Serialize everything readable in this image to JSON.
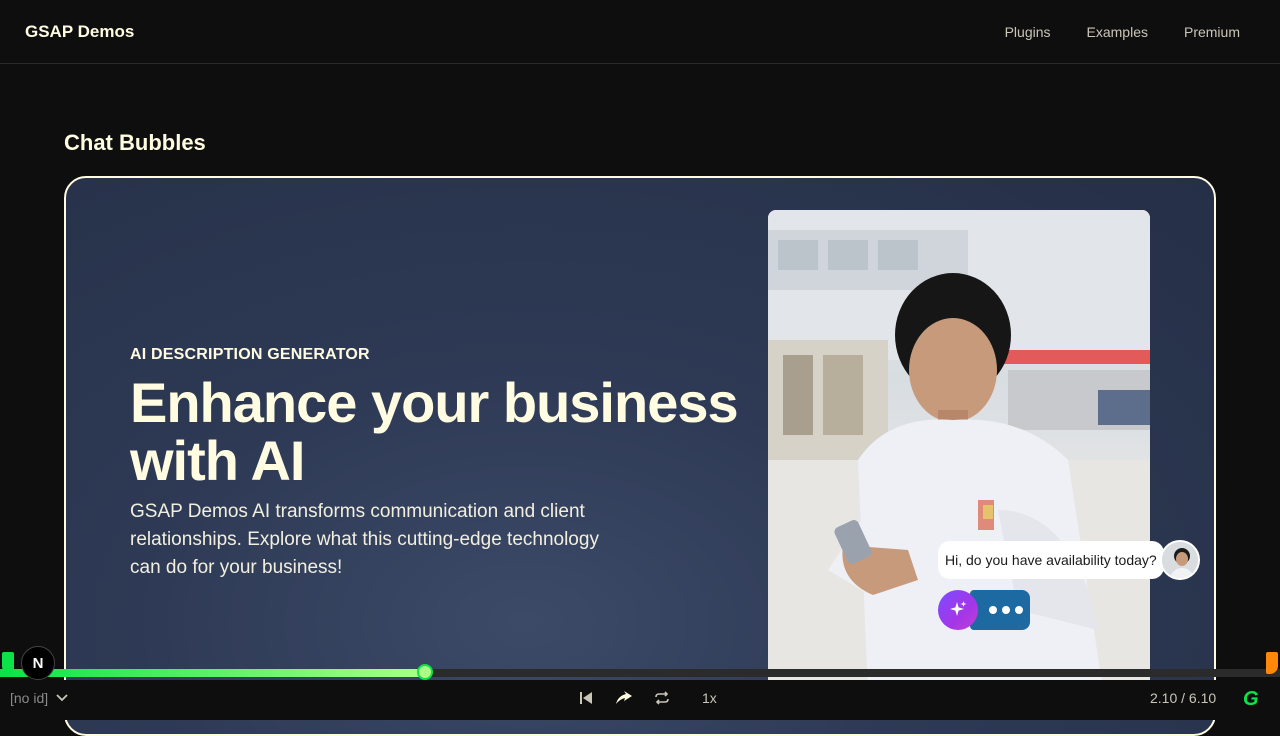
{
  "header": {
    "brand": "GSAP Demos",
    "nav": [
      "Plugins",
      "Examples",
      "Premium"
    ]
  },
  "section": {
    "title": "Chat Bubbles"
  },
  "hero": {
    "eyebrow": "AI DESCRIPTION GENERATOR",
    "headline_line1": "Enhance your business",
    "headline_line2": "with AI",
    "lede": "GSAP Demos AI transforms communication and client relationships. Explore what this cutting-edge technology can do for your business!"
  },
  "chat": {
    "message": "Hi, do you have availability today?",
    "ai_icon": "sparkles-icon",
    "typing_icon": "typing-dots-icon"
  },
  "player": {
    "animation_id": "[no id]",
    "speed": "1x",
    "time": "2.10 / 6.10",
    "progress": 0.344,
    "logo_letter": "N",
    "gsap_letter": "G"
  },
  "colors": {
    "accent_green": "#0ae448",
    "accent_orange": "#ff8709",
    "cream": "#fffce1",
    "card_bg": "#2e3a55",
    "typing_blue": "#1d6aa3"
  }
}
